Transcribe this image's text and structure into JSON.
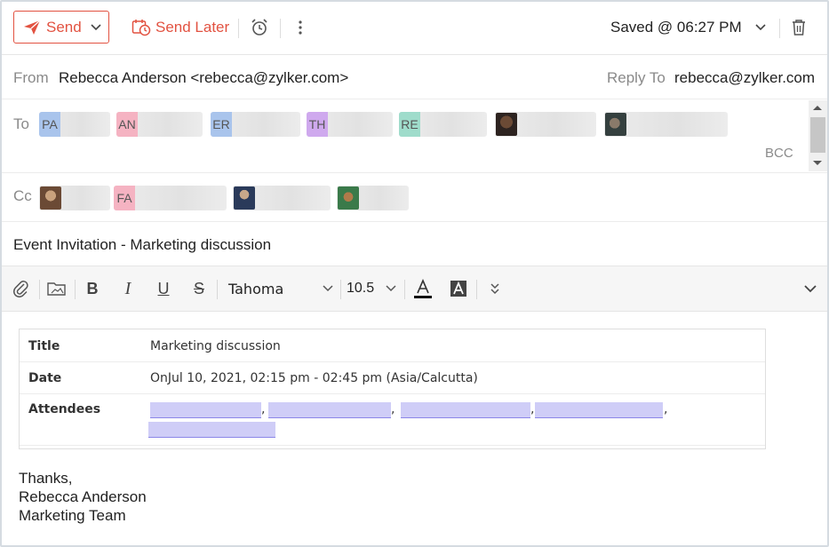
{
  "toolbar": {
    "send_label": "Send",
    "send_later_label": "Send Later",
    "saved_status": "Saved @ 06:27 PM"
  },
  "from": {
    "label": "From",
    "value": "Rebecca Anderson <rebecca@zylker.com>",
    "reply_to_label": "Reply To",
    "reply_to_value": "rebecca@zylker.com"
  },
  "to": {
    "label": "To",
    "chips": [
      {
        "initials": "PA",
        "color": "#a9c4ec"
      },
      {
        "initials": "AN",
        "color": "#f5b3c2"
      },
      {
        "initials": "ER",
        "color": "#a9c4ec"
      },
      {
        "initials": "TH",
        "color": "#cfa9ee"
      },
      {
        "initials": "RE",
        "color": "#9fdccb"
      },
      {
        "initials": "",
        "color": "#5a3a2a"
      },
      {
        "initials": "",
        "color": "#3a4a4a"
      }
    ],
    "bcc_label": "BCC"
  },
  "cc": {
    "label": "Cc",
    "chips": [
      {
        "initials": "",
        "color": "#8a5a3a"
      },
      {
        "initials": "FA",
        "color": "#f5b3c2"
      },
      {
        "initials": "",
        "color": "#2a3a5a"
      },
      {
        "initials": "",
        "color": "#3a7a4a"
      }
    ]
  },
  "subject": "Event Invitation - Marketing discussion",
  "format_bar": {
    "font": "Tahoma",
    "size": "10.5"
  },
  "event": {
    "title_label": "Title",
    "title_value": "Marketing discussion",
    "date_label": "Date",
    "date_value": "OnJul 10, 2021, 02:15 pm - 02:45 pm (Asia/Calcutta)",
    "attendees_label": "Attendees"
  },
  "signature": {
    "line1": "Thanks,",
    "line2": "Rebecca Anderson",
    "line3": "Marketing Team"
  },
  "colors": {
    "accent": "#e25241"
  }
}
